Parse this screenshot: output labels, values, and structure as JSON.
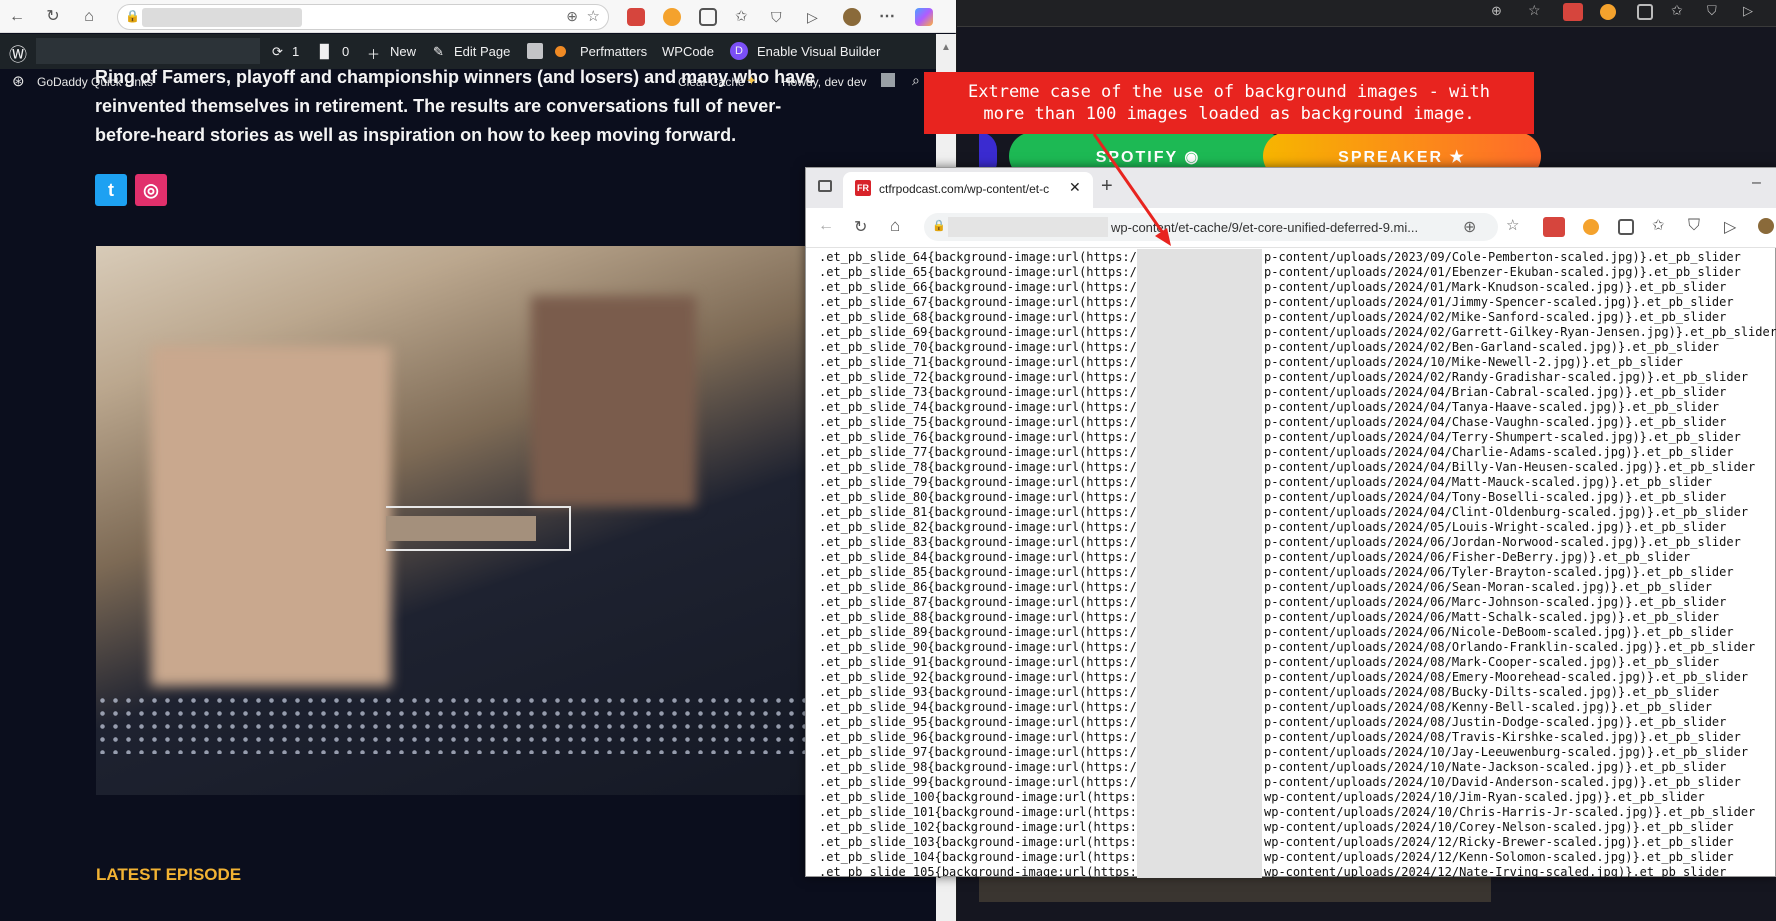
{
  "left_browser": {
    "wp_admin_bar": {
      "updates_count": "1",
      "comments_count": "0",
      "new_label": "New",
      "edit_page_label": "Edit Page",
      "perfmatters_label": "Perfmatters",
      "wpcode_label": "WPCode",
      "visual_builder_label": "Enable Visual Builder"
    },
    "godaddy_bar": {
      "quick_links": "GoDaddy Quick Links",
      "clear_cache": "Clear Cache",
      "howdy": "Howdy, dev dev"
    },
    "hero_text": "Ring of Famers, playoff and championship winners (and losers) and many who have reinvented themselves in retirement. The results are conversations full of never-before-heard stories as well as inspiration on how to keep moving forward.",
    "latest_episode_label": "LATEST EPISODE"
  },
  "right_background": {
    "spotify_label": "SPOTIFY",
    "spreaker_label": "SPREAKER"
  },
  "annotation": {
    "line1": "Extreme case of the use of background images - with",
    "line2": "more than 100 images loaded as background image."
  },
  "popup": {
    "tab_title": "ctfrpodcast.com/wp-content/et-c",
    "address": "wp-content/et-cache/9/et-core-unified-deferred-9.mi...",
    "lines": [
      {
        "sel": ".et_pb_slide_64{background-image:url(https:/",
        "path": "p-content/uploads/2023/09/Cole-Pemberton-scaled.jpg)}.et_pb_slider"
      },
      {
        "sel": ".et_pb_slide_65{background-image:url(https:/",
        "path": "p-content/uploads/2024/01/Ebenzer-Ekuban-scaled.jpg)}.et_pb_slider"
      },
      {
        "sel": ".et_pb_slide_66{background-image:url(https:/",
        "path": "p-content/uploads/2024/01/Mark-Knudson-scaled.jpg)}.et_pb_slider"
      },
      {
        "sel": ".et_pb_slide_67{background-image:url(https:/",
        "path": "p-content/uploads/2024/01/Jimmy-Spencer-scaled.jpg)}.et_pb_slider"
      },
      {
        "sel": ".et_pb_slide_68{background-image:url(https:/",
        "path": "p-content/uploads/2024/02/Mike-Sanford-scaled.jpg)}.et_pb_slider"
      },
      {
        "sel": ".et_pb_slide_69{background-image:url(https:/",
        "path": "p-content/uploads/2024/02/Garrett-Gilkey-Ryan-Jensen.jpg)}.et_pb_slider"
      },
      {
        "sel": ".et_pb_slide_70{background-image:url(https:/",
        "path": "p-content/uploads/2024/02/Ben-Garland-scaled.jpg)}.et_pb_slider"
      },
      {
        "sel": ".et_pb_slide_71{background-image:url(https:/",
        "path": "p-content/uploads/2024/10/Mike-Newell-2.jpg)}.et_pb_slider"
      },
      {
        "sel": ".et_pb_slide_72{background-image:url(https:/",
        "path": "p-content/uploads/2024/02/Randy-Gradishar-scaled.jpg)}.et_pb_slider"
      },
      {
        "sel": ".et_pb_slide_73{background-image:url(https:/",
        "path": "p-content/uploads/2024/04/Brian-Cabral-scaled.jpg)}.et_pb_slider"
      },
      {
        "sel": ".et_pb_slide_74{background-image:url(https:/",
        "path": "p-content/uploads/2024/04/Tanya-Haave-scaled.jpg)}.et_pb_slider"
      },
      {
        "sel": ".et_pb_slide_75{background-image:url(https:/",
        "path": "p-content/uploads/2024/04/Chase-Vaughn-scaled.jpg)}.et_pb_slider"
      },
      {
        "sel": ".et_pb_slide_76{background-image:url(https:/",
        "path": "p-content/uploads/2024/04/Terry-Shumpert-scaled.jpg)}.et_pb_slider"
      },
      {
        "sel": ".et_pb_slide_77{background-image:url(https:/",
        "path": "p-content/uploads/2024/04/Charlie-Adams-scaled.jpg)}.et_pb_slider"
      },
      {
        "sel": ".et_pb_slide_78{background-image:url(https:/",
        "path": "p-content/uploads/2024/04/Billy-Van-Heusen-scaled.jpg)}.et_pb_slider"
      },
      {
        "sel": ".et_pb_slide_79{background-image:url(https:/",
        "path": "p-content/uploads/2024/04/Matt-Mauck-scaled.jpg)}.et_pb_slider"
      },
      {
        "sel": ".et_pb_slide_80{background-image:url(https:/",
        "path": "p-content/uploads/2024/04/Tony-Boselli-scaled.jpg)}.et_pb_slider"
      },
      {
        "sel": ".et_pb_slide_81{background-image:url(https:/",
        "path": "p-content/uploads/2024/04/Clint-Oldenburg-scaled.jpg)}.et_pb_slider"
      },
      {
        "sel": ".et_pb_slide_82{background-image:url(https:/",
        "path": "p-content/uploads/2024/05/Louis-Wright-scaled.jpg)}.et_pb_slider"
      },
      {
        "sel": ".et_pb_slide_83{background-image:url(https:/",
        "path": "p-content/uploads/2024/06/Jordan-Norwood-scaled.jpg)}.et_pb_slider"
      },
      {
        "sel": ".et_pb_slide_84{background-image:url(https:/",
        "path": "p-content/uploads/2024/06/Fisher-DeBerry.jpg)}.et_pb_slider"
      },
      {
        "sel": ".et_pb_slide_85{background-image:url(https:/",
        "path": "p-content/uploads/2024/06/Tyler-Brayton-scaled.jpg)}.et_pb_slider"
      },
      {
        "sel": ".et_pb_slide_86{background-image:url(https:/",
        "path": "p-content/uploads/2024/06/Sean-Moran-scaled.jpg)}.et_pb_slider"
      },
      {
        "sel": ".et_pb_slide_87{background-image:url(https:/",
        "path": "p-content/uploads/2024/06/Marc-Johnson-scaled.jpg)}.et_pb_slider"
      },
      {
        "sel": ".et_pb_slide_88{background-image:url(https:/",
        "path": "p-content/uploads/2024/06/Matt-Schalk-scaled.jpg)}.et_pb_slider"
      },
      {
        "sel": ".et_pb_slide_89{background-image:url(https:/",
        "path": "p-content/uploads/2024/06/Nicole-DeBoom-scaled.jpg)}.et_pb_slider"
      },
      {
        "sel": ".et_pb_slide_90{background-image:url(https:/",
        "path": "p-content/uploads/2024/08/Orlando-Franklin-scaled.jpg)}.et_pb_slider"
      },
      {
        "sel": ".et_pb_slide_91{background-image:url(https:/",
        "path": "p-content/uploads/2024/08/Mark-Cooper-scaled.jpg)}.et_pb_slider"
      },
      {
        "sel": ".et_pb_slide_92{background-image:url(https:/",
        "path": "p-content/uploads/2024/08/Emery-Moorehead-scaled.jpg)}.et_pb_slider"
      },
      {
        "sel": ".et_pb_slide_93{background-image:url(https:/",
        "path": "p-content/uploads/2024/08/Bucky-Dilts-scaled.jpg)}.et_pb_slider"
      },
      {
        "sel": ".et_pb_slide_94{background-image:url(https:/",
        "path": "p-content/uploads/2024/08/Kenny-Bell-scaled.jpg)}.et_pb_slider"
      },
      {
        "sel": ".et_pb_slide_95{background-image:url(https:/",
        "path": "p-content/uploads/2024/08/Justin-Dodge-scaled.jpg)}.et_pb_slider"
      },
      {
        "sel": ".et_pb_slide_96{background-image:url(https:/",
        "path": "p-content/uploads/2024/08/Travis-Kirshke-scaled.jpg)}.et_pb_slider"
      },
      {
        "sel": ".et_pb_slide_97{background-image:url(https:/",
        "path": "p-content/uploads/2024/10/Jay-Leeuwenburg-scaled.jpg)}.et_pb_slider"
      },
      {
        "sel": ".et_pb_slide_98{background-image:url(https:/",
        "path": "p-content/uploads/2024/10/Nate-Jackson-scaled.jpg)}.et_pb_slider"
      },
      {
        "sel": ".et_pb_slide_99{background-image:url(https:/",
        "path": "p-content/uploads/2024/10/David-Anderson-scaled.jpg)}.et_pb_slider"
      },
      {
        "sel": ".et_pb_slide_100{background-image:url(https:",
        "path": "wp-content/uploads/2024/10/Jim-Ryan-scaled.jpg)}.et_pb_slider"
      },
      {
        "sel": ".et_pb_slide_101{background-image:url(https:",
        "path": "wp-content/uploads/2024/10/Chris-Harris-Jr-scaled.jpg)}.et_pb_slider"
      },
      {
        "sel": ".et_pb_slide_102{background-image:url(https:",
        "path": "wp-content/uploads/2024/10/Corey-Nelson-scaled.jpg)}.et_pb_slider"
      },
      {
        "sel": ".et_pb_slide_103{background-image:url(https:",
        "path": "wp-content/uploads/2024/12/Ricky-Brewer-scaled.jpg)}.et_pb_slider"
      },
      {
        "sel": ".et_pb_slide_104{background-image:url(https:",
        "path": "wp-content/uploads/2024/12/Kenn-Solomon-scaled.jpg)}.et_pb_slider"
      },
      {
        "sel": ".et_pb_slide_105{background-image:url(https:",
        "path": "wp-content/uploads/2024/12/Nate-Irving-scaled.jpg)}.et_pb_slider"
      }
    ]
  },
  "colors": {
    "callout_red": "#e8241f",
    "latest_gold": "#f2b233",
    "spotify_green": "#1db954",
    "spreaker_gradient": "#f7b500",
    "twitter_blue": "#1da1f2",
    "instagram_pink": "#e1306c"
  }
}
